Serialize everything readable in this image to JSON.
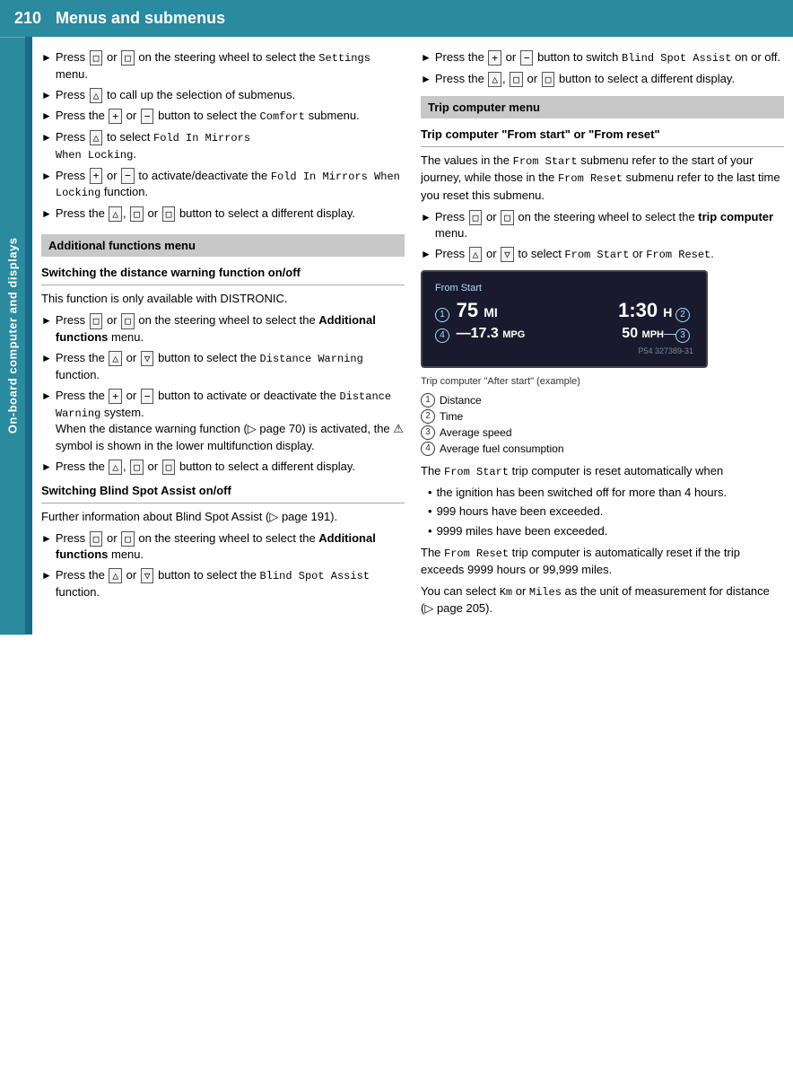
{
  "header": {
    "page_number": "210",
    "title": "Menus and submenus"
  },
  "sidebar": {
    "label": "On-board computer and displays"
  },
  "left_column": {
    "intro_bullets": [
      {
        "id": 1,
        "text_before": "Press",
        "btn1": "⊡",
        "text_mid": "or",
        "btn2": "⊟",
        "text_after": "on the steering wheel to select the",
        "mono": "Settings",
        "text_end": "menu."
      },
      {
        "id": 2,
        "text_before": "Press",
        "btn1": "△",
        "text_after": "to call up the selection of submenus."
      },
      {
        "id": 3,
        "text_before": "Press the",
        "btn1": "+",
        "text_mid": "or",
        "btn2": "−",
        "text_after": "button to select the",
        "mono": "Comfort",
        "text_end": "submenu."
      },
      {
        "id": 4,
        "text_before": "Press",
        "btn1": "△",
        "text_after": "to select",
        "mono": "Fold In Mirrors When Locking",
        "text_end": "."
      },
      {
        "id": 5,
        "text_before": "Press",
        "btn1": "+",
        "text_mid": "or",
        "btn2": "−",
        "text_after": "to activate/deactivate the",
        "mono": "Fold In Mirrors When Locking",
        "text_end": "function."
      },
      {
        "id": 6,
        "text_before": "Press the",
        "btn1": "△",
        "btn2": "⊡",
        "text_mid": "or",
        "btn3": "⊟",
        "text_after": "button to select a different display."
      }
    ],
    "additional_functions_menu": {
      "section_label": "Additional functions menu",
      "switching_distance": {
        "title": "Switching the distance warning function on/off",
        "intro": "This function is only available with DISTRONIC.",
        "bullets": [
          "Press [⊡] or [⊟] on the steering wheel to select the Additional functions menu.",
          "Press the [△] or [▽] button to select the Distance Warning function.",
          "Press the [+] or [−] button to activate or deactivate the Distance Warning system.\nWhen the distance warning function (▷ page 70) is activated, the ⚠ symbol is shown in the lower multifunction display.",
          "Press the [△], [⊡] or [⊟] button to select a different display."
        ]
      },
      "switching_blind_spot": {
        "title": "Switching Blind Spot Assist on/off",
        "intro": "Further information about Blind Spot Assist (▷ page 191).",
        "bullets": [
          "Press [⊡] or [⊟] on the steering wheel to select the Additional functions menu.",
          "Press the [△] or [▽] button to select the Blind Spot Assist function."
        ]
      }
    }
  },
  "right_column": {
    "blind_spot_bullets": [
      "Press the [+] or [−] button to switch Blind Spot Assist on or off.",
      "Press the [△], [⊡] or [⊟] button to select a different display."
    ],
    "trip_computer_menu": {
      "section_label": "Trip computer menu",
      "title": "Trip computer \"From start\" or \"From reset\"",
      "description": "The values in the From Start submenu refer to the start of your journey, while those in the From Reset submenu refer to the last time you reset this submenu.",
      "bullets": [
        "Press [⊡] or [⊟] on the steering wheel to select the trip computer menu.",
        "Press [△] or [▽] to select From Start or From Reset."
      ],
      "trip_image": {
        "label": "From Start",
        "circle1": "1",
        "value1": "75 MI",
        "circle2": "2",
        "value2": "1:30 H",
        "circle3": "3",
        "value3": "50 MPH",
        "circle4": "4",
        "value4": "17.3 MPG",
        "caption": "Trip computer \"After start\" (example)",
        "legend": [
          {
            "num": "1",
            "text": "Distance"
          },
          {
            "num": "2",
            "text": "Time"
          },
          {
            "num": "3",
            "text": "Average speed"
          },
          {
            "num": "4",
            "text": "Average fuel consumption"
          }
        ],
        "ref_code": "P54 327389-31"
      },
      "from_start_reset": {
        "intro": "The From Start trip computer is reset automatically when",
        "items": [
          "the ignition has been switched off for more than 4 hours.",
          "999 hours have been exceeded.",
          "9999 miles have been exceeded."
        ],
        "from_reset_text": "The From Reset trip computer is automatically reset if the trip exceeds 9999 hours or 99,999 miles.",
        "unit_text": "You can select Km or Miles as the unit of measurement for distance (▷ page 205)."
      }
    }
  }
}
